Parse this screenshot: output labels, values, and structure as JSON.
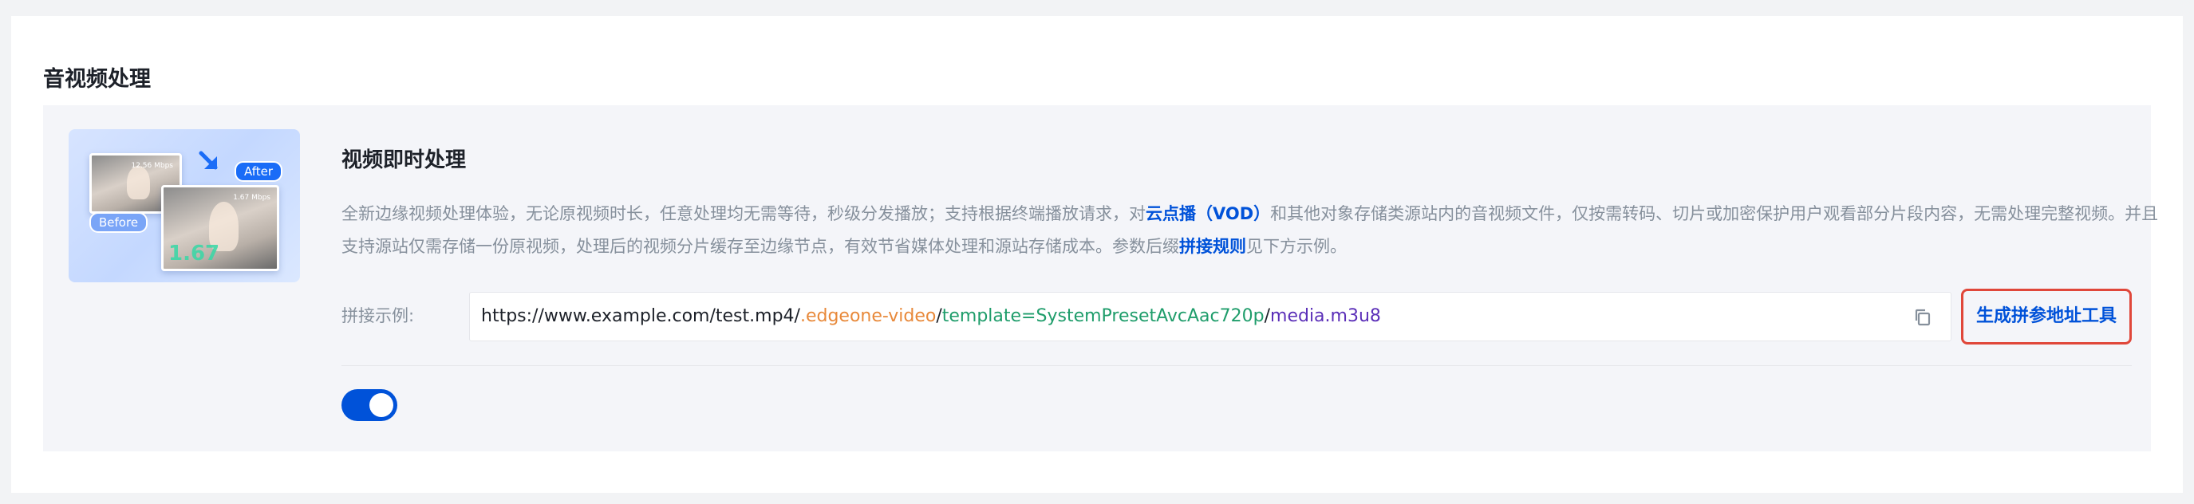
{
  "card": {
    "title": "音视频处理"
  },
  "feature": {
    "title": "视频即时处理",
    "thumbnail": {
      "after_label": "After",
      "before_label": "Before",
      "before_rate": "12.56 Mbps",
      "after_rate": "1.67 Mbps",
      "after_overlay": "1.67"
    },
    "description": {
      "part1": "全新边缘视频处理体验，无论原视频时长，任意处理均无需等待，秒级分发播放；支持根据终端播放请求，对",
      "link1": "云点播（VOD）",
      "part2": "和其他对象存储类源站内的音视频文件，仅按需转码、切片或加密保护用户观看部分片段内容，无需处理完整视频。并且支持源站仅需存储一份原视频，处理后的视频分片缓存至边缘节点，有效节省媒体处理和源站存储成本。参数后缀",
      "link2": "拼接规则",
      "part3": "见下方示例。"
    },
    "example": {
      "label": "拼接示例:",
      "url_base": "https://www.example.com/test.mp4",
      "slash": "/",
      "url_video": ".edgeone-video",
      "url_template": "template=SystemPresetAvcAac720p",
      "url_media": "media.m3u8",
      "copy_icon": "copy-icon"
    },
    "generate_button": "生成拼参地址工具",
    "toggle": {
      "enabled": true
    }
  },
  "colors": {
    "accent": "#0052d9",
    "highlight_border": "#e0473a",
    "segment_video": "#e8893a",
    "segment_template": "#1f9d6b",
    "segment_media": "#5b2fb8"
  }
}
